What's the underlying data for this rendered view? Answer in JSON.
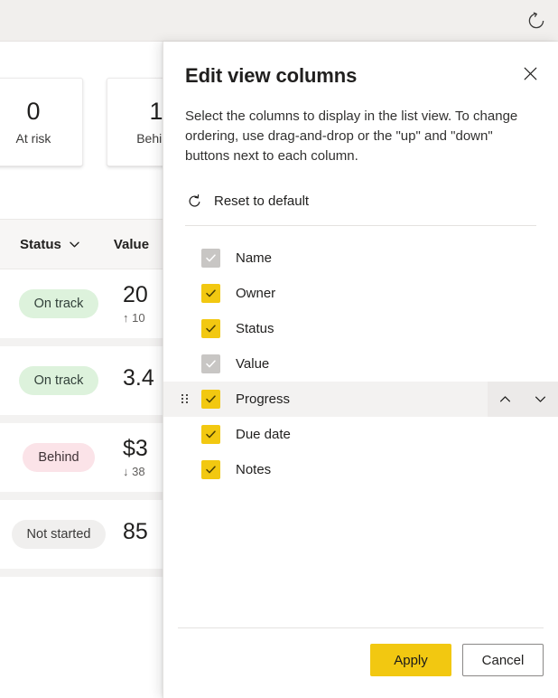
{
  "app": {
    "refresh_icon": "refresh-icon",
    "cards": [
      {
        "number": "0",
        "label": "At risk"
      },
      {
        "number": "1",
        "label": "Behind"
      }
    ],
    "table": {
      "columns": [
        {
          "label": "Status",
          "sort_icon": "chevron-down-icon"
        },
        {
          "label": "Value",
          "sort_icon": ""
        }
      ],
      "rows": [
        {
          "status": "On track",
          "status_kind": "ontrack",
          "value": "20",
          "delta": "↑ 10"
        },
        {
          "status": "On track",
          "status_kind": "ontrack",
          "value": "3.4",
          "delta": ""
        },
        {
          "status": "Behind",
          "status_kind": "behind",
          "value": "$3",
          "delta": "↓ 38"
        },
        {
          "status": "Not started",
          "status_kind": "notstarted",
          "value": "85",
          "delta": ""
        }
      ]
    }
  },
  "panel": {
    "title": "Edit view columns",
    "close_icon": "close-icon",
    "description": "Select the columns to display in the list view. To change ordering, use drag-and-drop or the \"up\" and \"down\" buttons next to each column.",
    "reset": {
      "label": "Reset to default",
      "icon": "reset-arrow-icon"
    },
    "columns": [
      {
        "label": "Name",
        "checked": true,
        "enabled": false,
        "hovered": false
      },
      {
        "label": "Owner",
        "checked": true,
        "enabled": true,
        "hovered": false
      },
      {
        "label": "Status",
        "checked": true,
        "enabled": true,
        "hovered": false
      },
      {
        "label": "Value",
        "checked": true,
        "enabled": false,
        "hovered": false
      },
      {
        "label": "Progress",
        "checked": true,
        "enabled": true,
        "hovered": true
      },
      {
        "label": "Due date",
        "checked": true,
        "enabled": true,
        "hovered": false
      },
      {
        "label": "Notes",
        "checked": true,
        "enabled": true,
        "hovered": false
      }
    ],
    "move_up_icon": "chevron-up-icon",
    "move_down_icon": "chevron-down-icon",
    "drag_handle_icon": "drag-handle-icon",
    "footer": {
      "apply_label": "Apply",
      "cancel_label": "Cancel"
    }
  },
  "colors": {
    "accent_yellow": "#F2C811",
    "disabled_gray": "#C8C6C4",
    "pill_green": "#DDF2DC",
    "pill_pink": "#FBE3E8",
    "pill_gray": "#F0EFEE",
    "panel_bg": "#FFFFFF",
    "hover_row": "#F3F2F1",
    "topbar_bg": "#F1EFED"
  }
}
